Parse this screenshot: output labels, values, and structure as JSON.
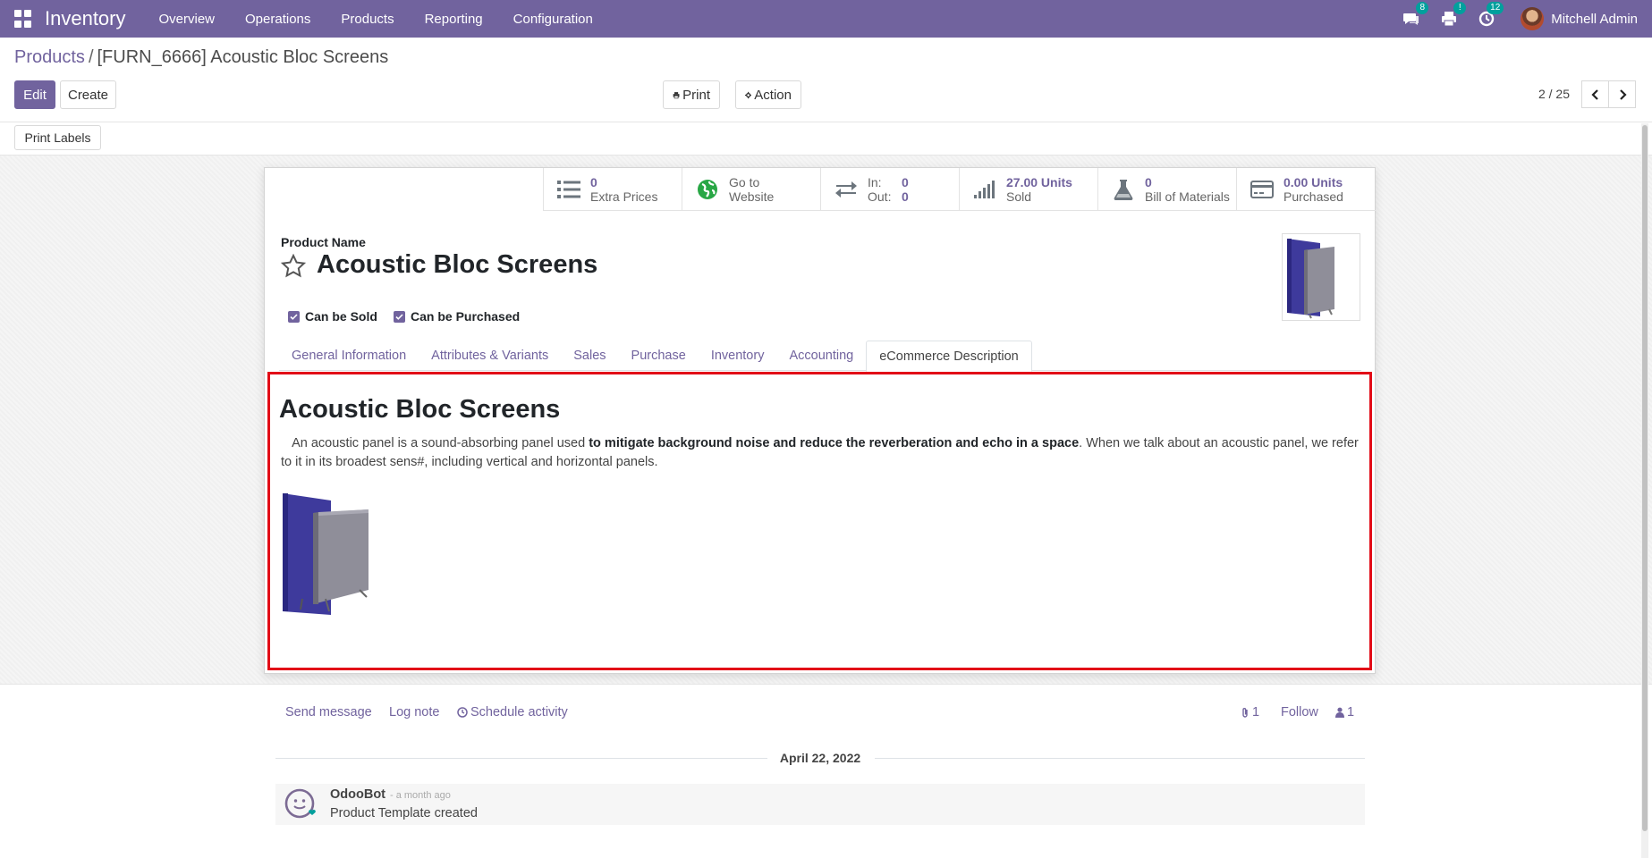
{
  "navbar": {
    "app_name": "Inventory",
    "menu": [
      "Overview",
      "Operations",
      "Products",
      "Reporting",
      "Configuration"
    ],
    "badges": {
      "messages": "8",
      "activities_warning": "!",
      "activities": "12"
    },
    "user_name": "Mitchell Admin",
    "color": "#71639e"
  },
  "breadcrumb": {
    "parent": "Products",
    "separator": "/",
    "current": "[FURN_6666] Acoustic Bloc Screens"
  },
  "toolbar": {
    "edit_label": "Edit",
    "create_label": "Create",
    "print_label": "Print",
    "action_label": "Action",
    "pager": "2 / 25",
    "print_labels_label": "Print Labels"
  },
  "smart_buttons": [
    {
      "value": "0",
      "label": "Extra Prices",
      "icon": "list-icon"
    },
    {
      "value": "Go to",
      "label": "Website",
      "icon": "globe-icon"
    },
    {
      "in_label": "In:",
      "in_value": "0",
      "out_label": "Out:",
      "out_value": "0",
      "icon": "exchange-icon"
    },
    {
      "value": "27.00 Units",
      "label": "Sold",
      "icon": "signal-icon"
    },
    {
      "value": "0",
      "label": "Bill of Materials",
      "icon": "flask-icon"
    },
    {
      "value": "0.00 Units",
      "label": "Purchased",
      "icon": "credit-card-icon"
    }
  ],
  "product": {
    "name_label": "Product Name",
    "name": "Acoustic Bloc Screens",
    "can_be_sold_label": "Can be Sold",
    "can_be_purchased_label": "Can be Purchased",
    "can_be_sold": true,
    "can_be_purchased": true
  },
  "tabs": [
    "General Information",
    "Attributes & Variants",
    "Sales",
    "Purchase",
    "Inventory",
    "Accounting",
    "eCommerce Description"
  ],
  "active_tab": "eCommerce Description",
  "description": {
    "title": "Acoustic Bloc Screens",
    "text_before": "An acoustic panel is a sound-absorbing panel used ",
    "text_bold": "to mitigate background noise and reduce the reverberation and echo in a space",
    "text_after": ". When we talk about an acoustic panel, we refer to it in its broadest sens#, including vertical and horizontal panels."
  },
  "chatter": {
    "send_message": "Send message",
    "log_note": "Log note",
    "schedule_activity": "Schedule activity",
    "attachments_count": "1",
    "follow_label": "Follow",
    "followers_count": "1",
    "date": "April 22, 2022",
    "message": {
      "author": "OdooBot",
      "time": "- a month ago",
      "body": "Product Template created"
    }
  },
  "colors": {
    "highlight_border": "#e20b17",
    "accent": "#71639e",
    "badge": "#00a09d"
  }
}
